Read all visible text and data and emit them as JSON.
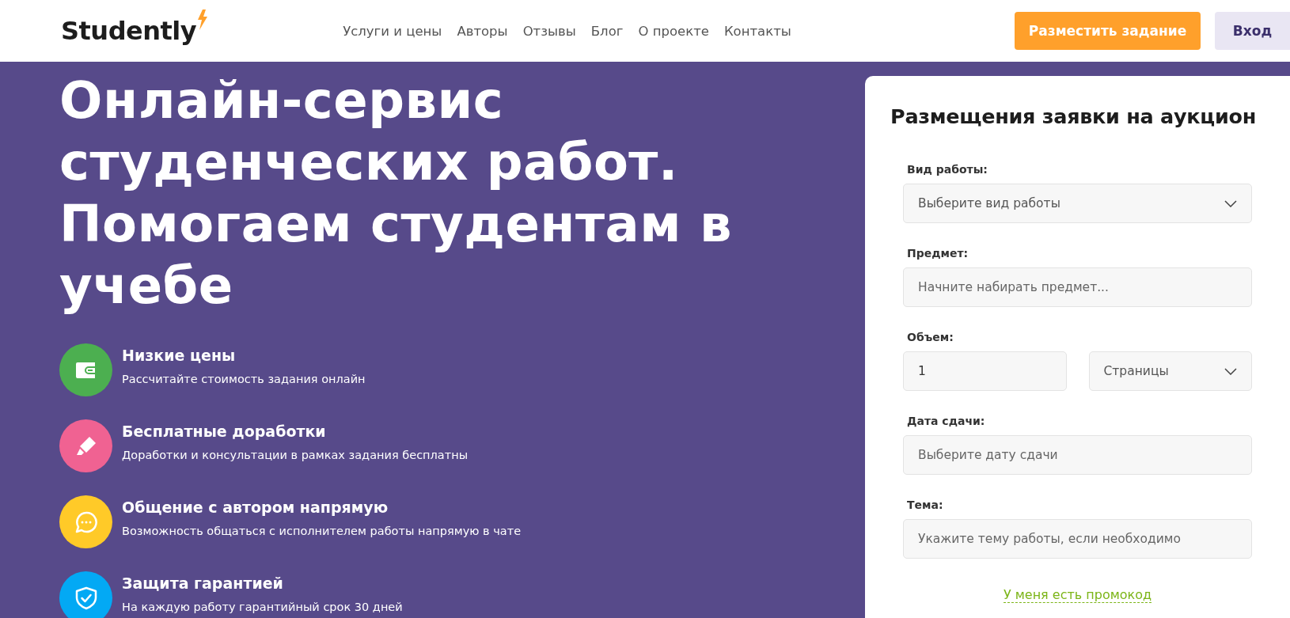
{
  "header": {
    "logo": "Studently",
    "nav": [
      "Услуги и цены",
      "Авторы",
      "Отзывы",
      "Блог",
      "О проекте",
      "Контакты"
    ],
    "cta_button": "Разместить задание",
    "login_button": "Вход"
  },
  "hero": {
    "title": "Онлайн-сервис студенческих работ. Помогаем студентам в учебе",
    "features": [
      {
        "title": "Низкие цены",
        "text": "Рассчитайте стоимость задания онлайн",
        "color": "#4caf50"
      },
      {
        "title": "Бесплатные доработки",
        "text": "Доработки и консультации в рамках задания бесплатны",
        "color": "#f06292"
      },
      {
        "title": "Общение с автором напрямую",
        "text": "Возможность общаться с исполнителем работы напрямую в чате",
        "color": "#ffca28"
      },
      {
        "title": "Защита гарантией",
        "text": "На каждую работу гарантийный срок 30 дней",
        "color": "#03a9f4"
      }
    ]
  },
  "form": {
    "title": "Размещения заявки на аукцион",
    "fields": [
      {
        "label": "Вид работы:",
        "controls": [
          {
            "kind": "select",
            "value": "Выберите вид работы"
          }
        ]
      },
      {
        "label": "Предмет:",
        "controls": [
          {
            "kind": "input",
            "placeholder": "Начните набирать предмет..."
          }
        ]
      },
      {
        "label": "Объем:",
        "controls": [
          {
            "kind": "input",
            "value": "1"
          },
          {
            "kind": "select",
            "value": "Страницы"
          }
        ]
      },
      {
        "label": "Дата сдачи:",
        "controls": [
          {
            "kind": "input",
            "placeholder": "Выберите дату сдачи"
          }
        ]
      },
      {
        "label": "Тема:",
        "controls": [
          {
            "kind": "input",
            "placeholder": "Укажите тему работы, если необходимо"
          }
        ]
      }
    ],
    "promo_link": "У меня есть промокод"
  }
}
